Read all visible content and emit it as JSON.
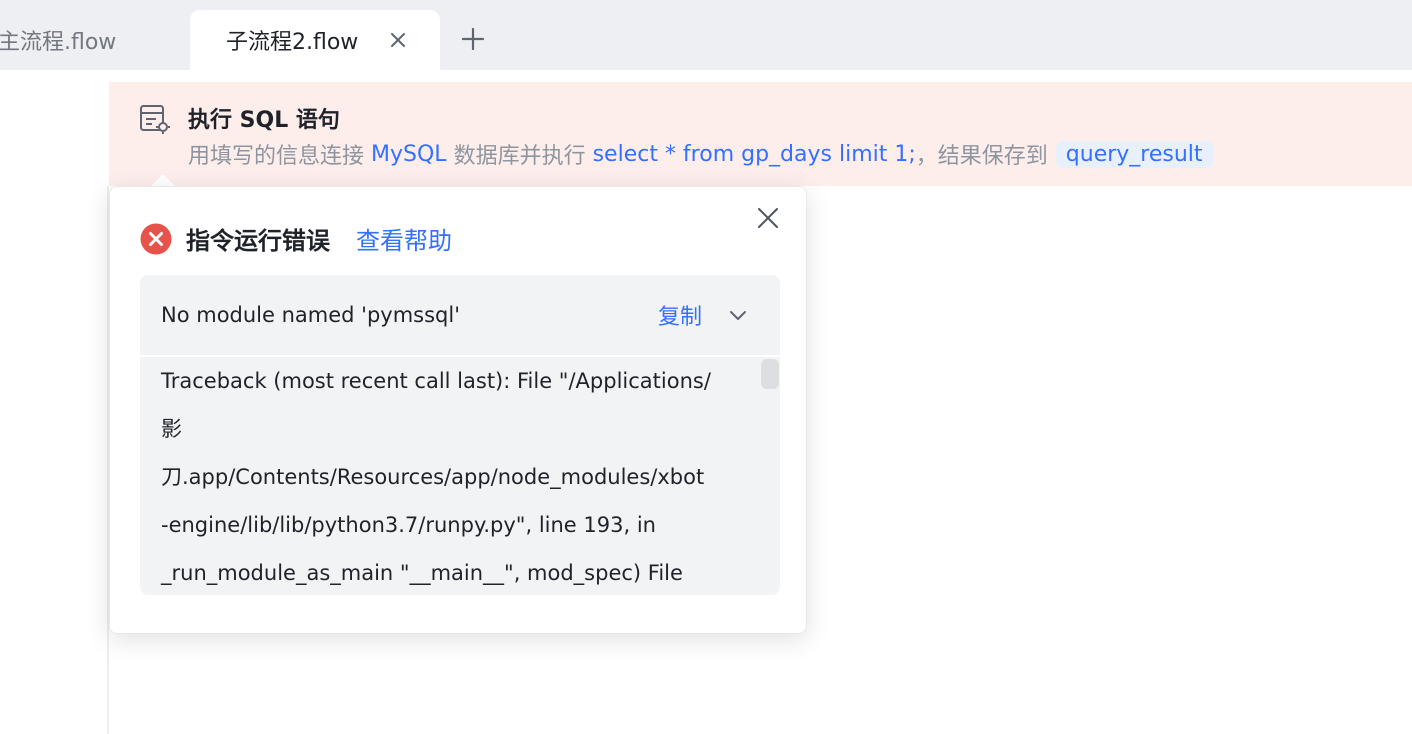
{
  "tabs": [
    {
      "label": "主流程.flow",
      "active": false
    },
    {
      "label": "子流程2.flow",
      "active": true
    }
  ],
  "tab_icons": {
    "close": "close-icon",
    "add": "plus-icon"
  },
  "step": {
    "icon": "sql-table-icon",
    "title": "执行 SQL 语句",
    "desc_prefix": "用填写的信息连接",
    "db": "MySQL",
    "desc_mid": "数据库并执行",
    "sql": "select * from gp_days limit 1;",
    "desc_suffix": "，结果保存到",
    "result_var": "query_result"
  },
  "error_popover": {
    "title": "指令运行错误",
    "help_link": "查看帮助",
    "message": "No module named 'pymssql'",
    "copy_label": "复制",
    "traceback_lines": [
      "Traceback (most recent call last): File \"/Applications/",
      "影",
      "刀.app/Contents/Resources/app/node_modules/xbot",
      "-engine/lib/lib/python3.7/runpy.py\", line 193, in",
      "_run_module_as_main \"__main__\", mod_spec) File"
    ]
  },
  "colors": {
    "accent": "#3370ff",
    "error": "#e5534b",
    "step_row_bg": "#fdeeec",
    "tabbar_bg": "#eeeff2"
  }
}
